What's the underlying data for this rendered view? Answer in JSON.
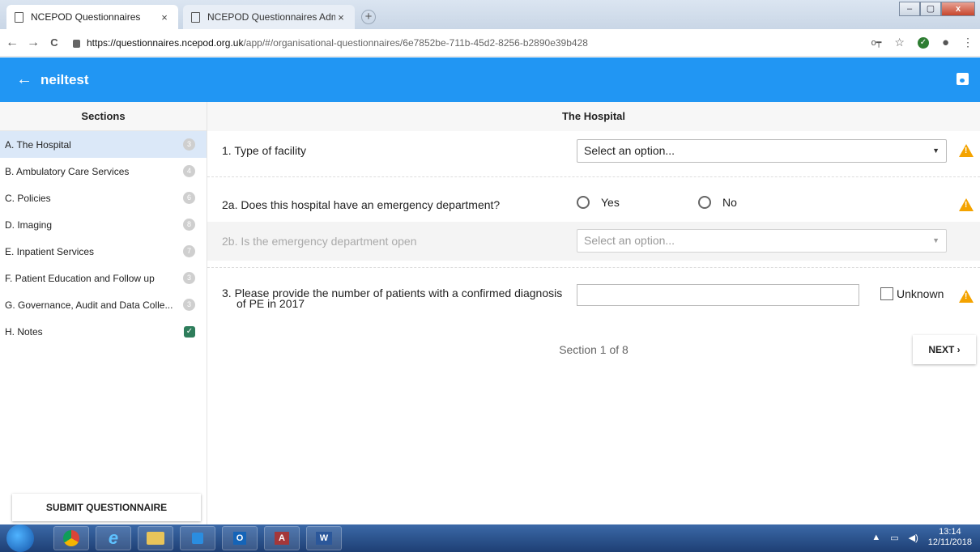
{
  "browser": {
    "tabs": [
      {
        "title": "NCEPOD Questionnaires",
        "close": "×"
      },
      {
        "title": "NCEPOD Questionnaires Admin",
        "close": "×"
      }
    ],
    "new_tab": "+",
    "url_host": "https://questionnaires.ncepod.org.uk",
    "url_path": "/app/#/organisational-questionnaires/6e7852be-711b-45d2-8256-b2890e39b428",
    "back": "←",
    "forward": "→",
    "reload": "C",
    "key": "o┯",
    "star": "☆",
    "menu": "⋮"
  },
  "appbar": {
    "back_arrow": "←",
    "title": "neiltest"
  },
  "sidebar": {
    "heading": "Sections",
    "items": [
      {
        "label": "A. The Hospital",
        "badge": "3",
        "active": true
      },
      {
        "label": "B. Ambulatory Care Services",
        "badge": "4"
      },
      {
        "label": "C. Policies",
        "badge": "6"
      },
      {
        "label": "D. Imaging",
        "badge": "8"
      },
      {
        "label": "E. Inpatient Services",
        "badge": "7"
      },
      {
        "label": "F. Patient Education and Follow up",
        "badge": "3"
      },
      {
        "label": "G. Governance, Audit and Data Colle...",
        "badge": "3"
      },
      {
        "label": "H. Notes",
        "badge": "✓",
        "complete": true
      }
    ],
    "submit_label": "SUBMIT QUESTIONNAIRE"
  },
  "main": {
    "section_title": "The Hospital",
    "q1": {
      "text": "1. Type of facility",
      "select_value": "Select an option..."
    },
    "q2a": {
      "text": "2a. Does this hospital have an emergency department?",
      "opt_yes": "Yes",
      "opt_no": "No"
    },
    "q2b": {
      "text": "2b. Is the emergency department open",
      "select_value": "Select an option..."
    },
    "q3": {
      "text_line1": "3. Please provide the number of patients with a confirmed diagnosis",
      "text_line2": "of PE in 2017",
      "value": "",
      "unknown_label": "Unknown"
    },
    "warning_symbol": "!",
    "select_arrow": "▼",
    "pager": "Section 1 of 8",
    "next_label": "NEXT ›"
  },
  "taskbar": {
    "time": "13:14",
    "date": "12/11/2018"
  },
  "colors": {
    "appbar": "#2196f3",
    "warning": "#f4a300",
    "active_section": "#dbe8f8"
  }
}
